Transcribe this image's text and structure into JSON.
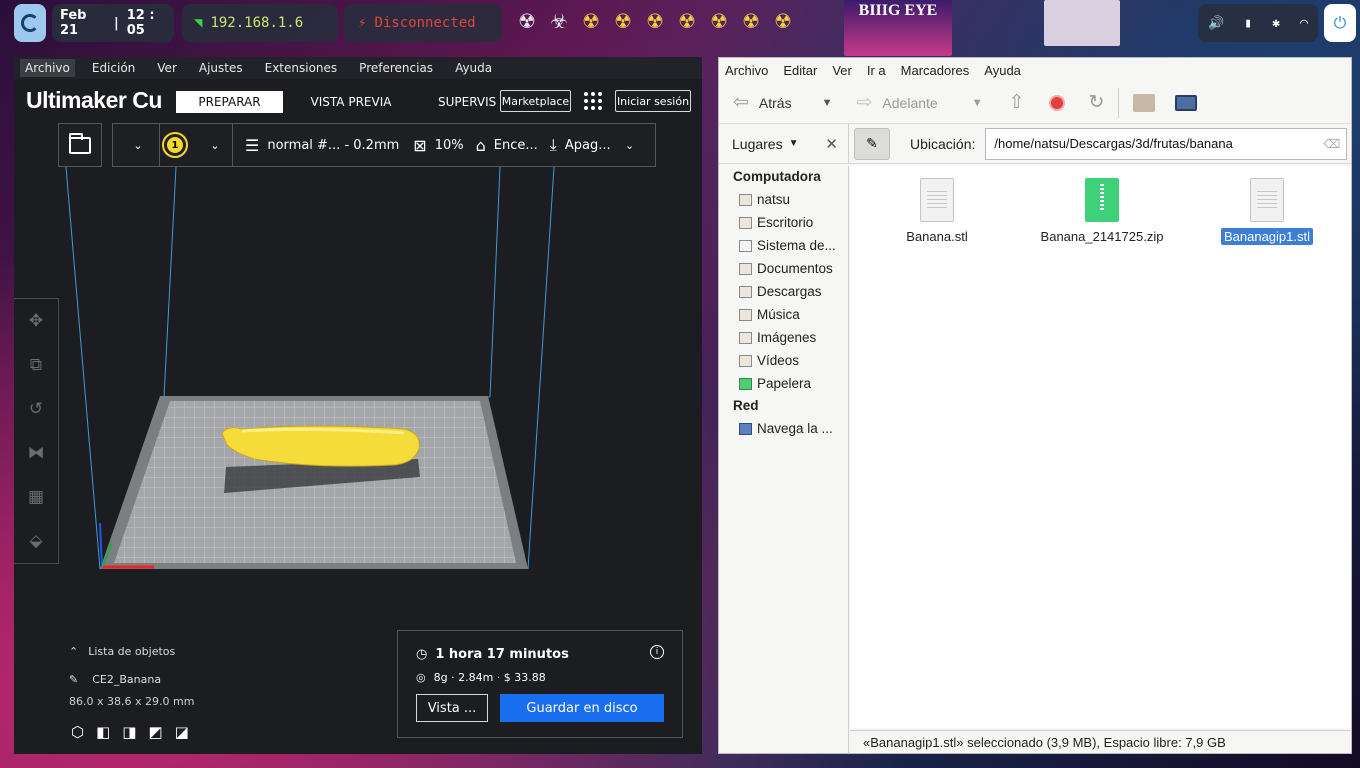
{
  "topbar": {
    "date": "Feb 21",
    "time": "12 : 05",
    "ip": "192.168.1.6",
    "vpn_status": "Disconnected",
    "poster_text": "BIIIG EYE",
    "colors": {
      "ip": "#c9e86b",
      "vpn": "#e0433a",
      "hazard": "#f2d23a"
    }
  },
  "cura": {
    "menu": [
      "Archivo",
      "Edición",
      "Ver",
      "Ajustes",
      "Extensiones",
      "Preferencias",
      "Ayuda"
    ],
    "brand": "Ultimaker Cu",
    "stages": {
      "prepare": "PREPARAR",
      "preview": "VISTA PREVIA",
      "monitor": "SUPERVIS"
    },
    "marketplace": "Marketplace",
    "signin": "Iniciar sesión",
    "extruder_number": "1",
    "profile": "normal #... - 0.2mm",
    "infill": "10%",
    "support": "Ence...",
    "adhesion": "Apag...",
    "object_list_label": "Lista de objetos",
    "object_name": "CE2_Banana",
    "object_dims": "86.0 x 38.6 x 29.0 mm",
    "print_time": "1 hora 17 minutos",
    "print_stats": "8g · 2.84m · $ 33.88",
    "view_button": "Vista ...",
    "save_button": "Guardar en disco",
    "accent": "#196ef0"
  },
  "fm": {
    "menu": [
      "Archivo",
      "Editar",
      "Ver",
      "Ir a",
      "Marcadores",
      "Ayuda"
    ],
    "back": "Atrás",
    "forward": "Adelante",
    "places": "Lugares",
    "location_label": "Ubicación:",
    "location_value": "/home/natsu/Descargas/3d/frutas/banana",
    "sidebar": {
      "computer": "Computadora",
      "items": [
        "natsu",
        "Escritorio",
        "Sistema de...",
        "Documentos",
        "Descargas",
        "Música",
        "Imágenes",
        "Vídeos",
        "Papelera"
      ],
      "network": "Red",
      "network_items": [
        "Navega la ..."
      ]
    },
    "files": [
      {
        "name": "Banana.stl",
        "type": "stl"
      },
      {
        "name": "Banana_2141725.zip",
        "type": "zip"
      },
      {
        "name": "Bananagip1.stl",
        "type": "stl"
      }
    ],
    "status": "«Bananagip1.stl» seleccionado (3,9 MB), Espacio libre: 7,9 GB",
    "selection_color": "#3d7fd6"
  }
}
